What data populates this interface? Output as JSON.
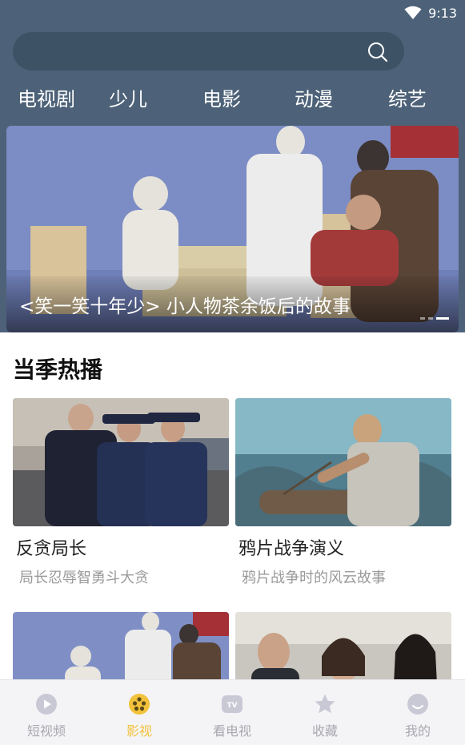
{
  "status_bar": {
    "time": "9:13"
  },
  "search": {
    "placeholder": ""
  },
  "category_tabs": [
    {
      "label": "电视剧"
    },
    {
      "label": "少儿"
    },
    {
      "label": "电影"
    },
    {
      "label": "动漫"
    },
    {
      "label": "综艺"
    }
  ],
  "banner": {
    "title": "<笑一笑十年少> 小人物茶余饭后的故事",
    "slide_count": 3,
    "active_slide": 3
  },
  "section": {
    "title": "当季热播"
  },
  "cards": [
    {
      "title": "反贪局长",
      "subtitle": "局长忍辱智勇斗大贪"
    },
    {
      "title": "鸦片战争演义",
      "subtitle": "鸦片战争时的风云故事"
    },
    {
      "title": "",
      "subtitle": ""
    },
    {
      "title": "",
      "subtitle": ""
    }
  ],
  "bottom_nav": [
    {
      "label": "短视频",
      "icon": "play-circle-icon"
    },
    {
      "label": "影视",
      "icon": "film-reel-icon",
      "active": true
    },
    {
      "label": "看电视",
      "icon": "tv-icon"
    },
    {
      "label": "收藏",
      "icon": "star-icon"
    },
    {
      "label": "我的",
      "icon": "profile-icon"
    }
  ],
  "colors": {
    "header_bg": "#4d6278",
    "search_bg": "#3e5265",
    "active_accent": "#f2c23a",
    "inactive_nav": "#a8a8b0"
  }
}
